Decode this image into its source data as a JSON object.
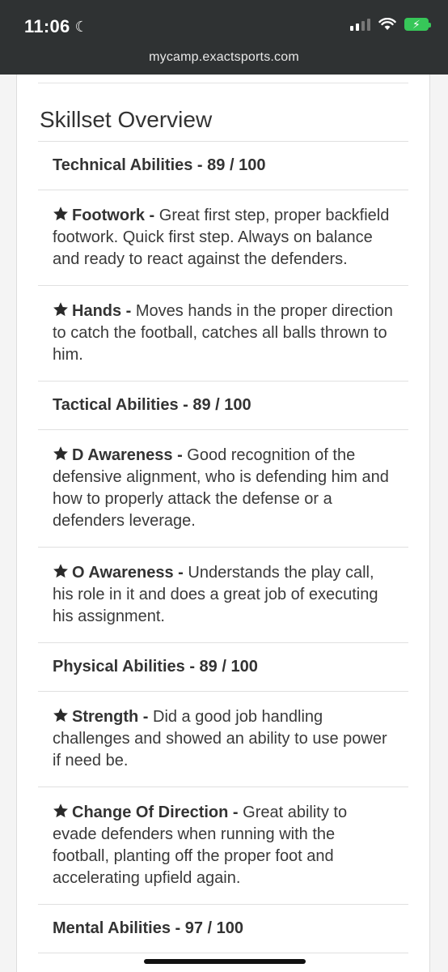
{
  "status": {
    "time": "11:06",
    "url": "mycamp.exactsports.com"
  },
  "overview": {
    "title": "Skillset Overview",
    "sections": [
      {
        "heading": "Technical Abilities - 89 / 100",
        "skills": [
          {
            "name": "Footwork -",
            "text": " Great first step, proper backfield footwork. Quick first step. Always on balance and ready to react against the defenders."
          },
          {
            "name": "Hands -",
            "text": " Moves hands in the proper direction to catch the football, catches all balls thrown to him."
          }
        ]
      },
      {
        "heading": "Tactical Abilities - 89 / 100",
        "skills": [
          {
            "name": "D Awareness -",
            "text": " Good recognition of the defensive alignment, who is defending him and how to properly attack the defense or a defenders leverage."
          },
          {
            "name": "O Awareness -",
            "text": " Understands the play call, his role in it and does a great job of executing his assignment."
          }
        ]
      },
      {
        "heading": "Physical Abilities - 89 / 100",
        "skills": [
          {
            "name": "Strength -",
            "text": " Did a good job handling challenges and showed an ability to use power if need be."
          },
          {
            "name": "Change Of Direction -",
            "text": " Great ability to evade defenders when running with the football, planting off the proper foot and accelerating upfield again."
          }
        ]
      },
      {
        "heading": "Mental Abilities - 97 / 100",
        "skills": []
      }
    ]
  }
}
